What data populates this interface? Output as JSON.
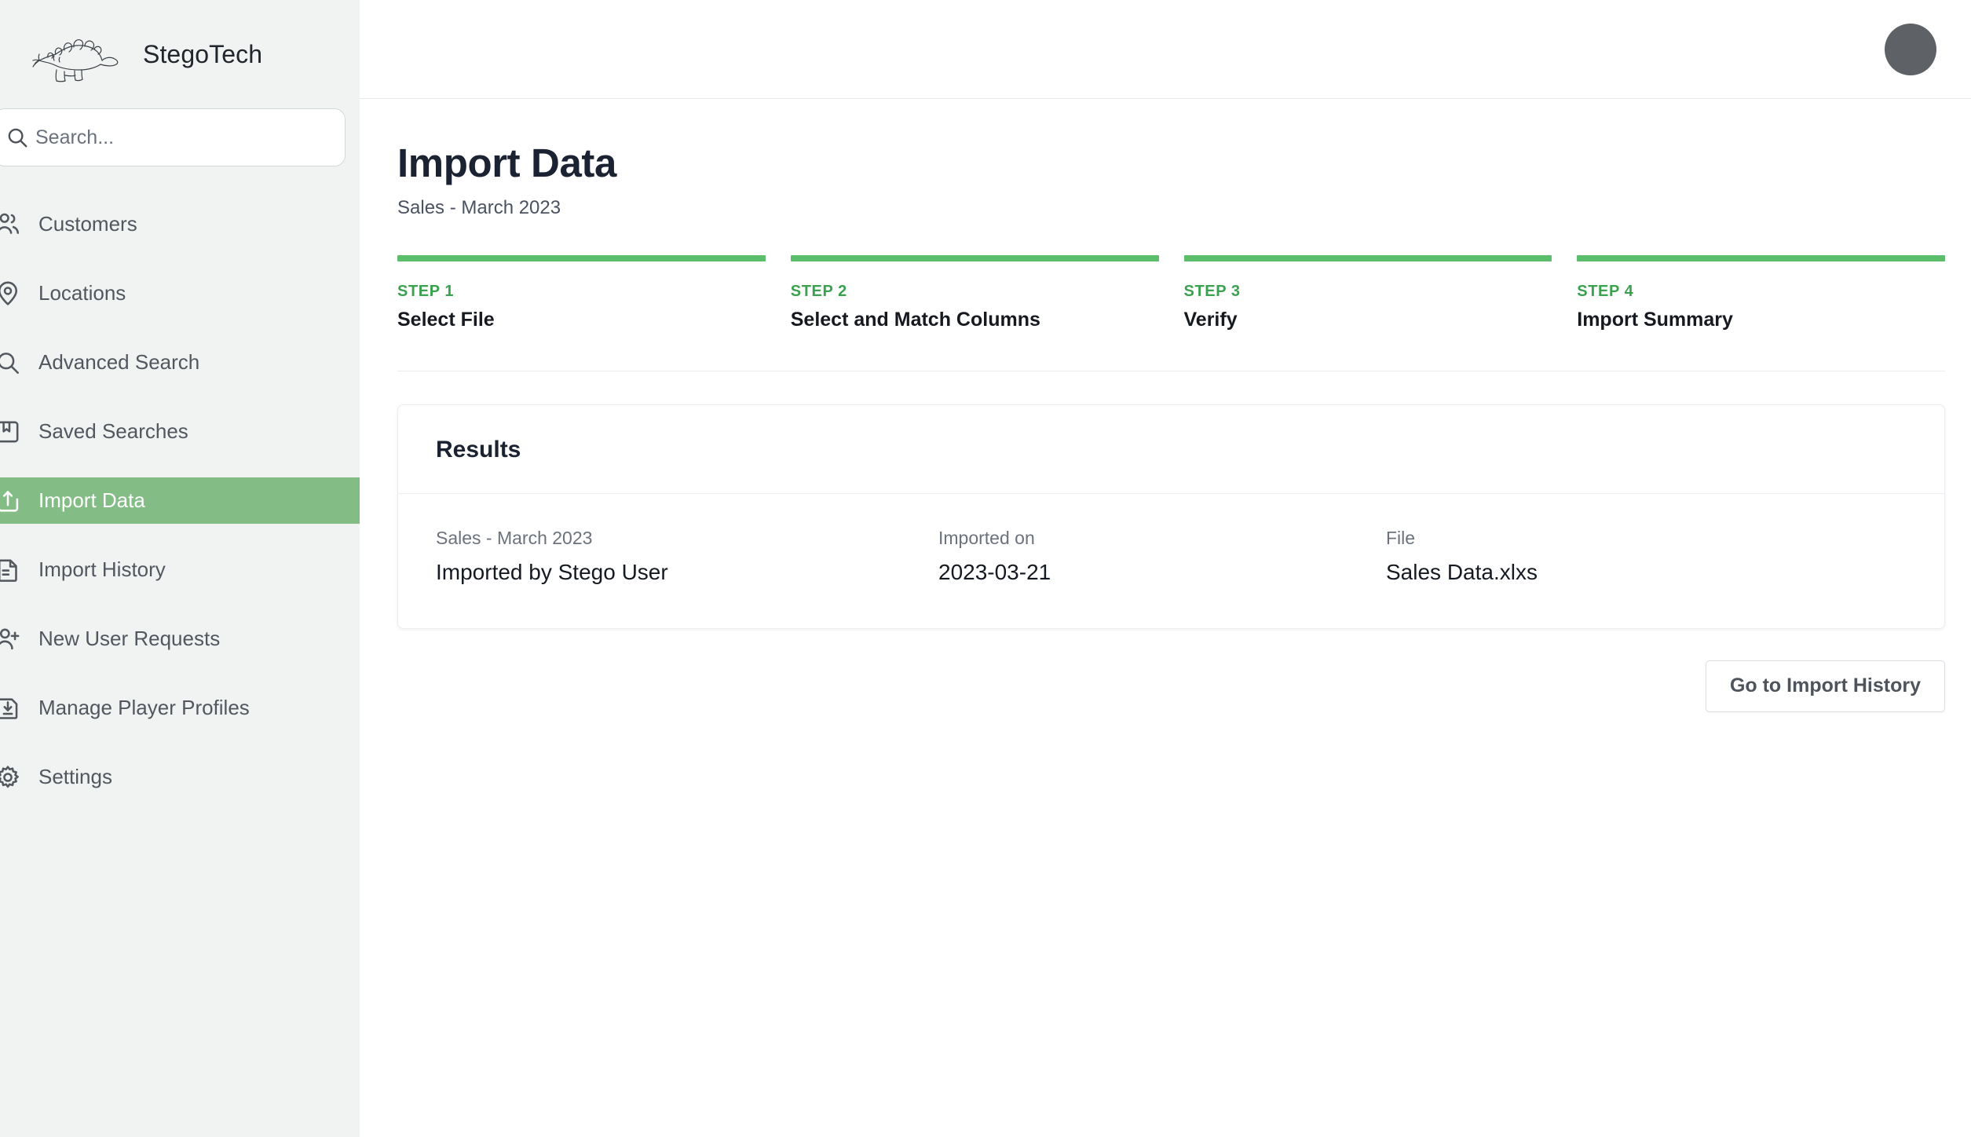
{
  "brand": {
    "name": "StegoTech",
    "logo_icon": "stegosaurus-logo-icon"
  },
  "search": {
    "placeholder": "Search...",
    "value": "",
    "icon": "search-icon"
  },
  "sidebar": {
    "items": [
      {
        "label": "Customers",
        "icon": "users-icon",
        "active": false
      },
      {
        "label": "Locations",
        "icon": "map-pin-icon",
        "active": false
      },
      {
        "label": "Advanced Search",
        "icon": "search-icon",
        "active": false
      },
      {
        "label": "Saved Searches",
        "icon": "bookmark-doc-icon",
        "active": false
      },
      {
        "label": "Import Data",
        "icon": "upload-file-icon",
        "active": true
      },
      {
        "label": "Import History",
        "icon": "list-doc-icon",
        "active": false
      },
      {
        "label": "New User Requests",
        "icon": "user-plus-icon",
        "active": false
      },
      {
        "label": "Manage Player Profiles",
        "icon": "download-file-icon",
        "active": false
      },
      {
        "label": "Settings",
        "icon": "gear-icon",
        "active": false
      }
    ]
  },
  "topbar": {
    "avatar_icon": "avatar",
    "avatar_color": "#5e6166"
  },
  "page": {
    "title": "Import Data",
    "subtitle": "Sales - March 2023"
  },
  "stepper": {
    "accent_color": "#5cbd6b",
    "label_color": "#3aa14e",
    "steps": [
      {
        "index": "STEP 1",
        "name": "Select File",
        "complete": true
      },
      {
        "index": "STEP 2",
        "name": "Select and Match Columns",
        "complete": true
      },
      {
        "index": "STEP 3",
        "name": "Verify",
        "complete": true
      },
      {
        "index": "STEP 4",
        "name": "Import Summary",
        "complete": true
      }
    ]
  },
  "results_card": {
    "title": "Results",
    "fields": [
      {
        "label": "Sales - March 2023",
        "value": "Imported by Stego User"
      },
      {
        "label": "Imported on",
        "value": "2023-03-21"
      },
      {
        "label": "File",
        "value": "Sales Data.xlxs"
      }
    ]
  },
  "actions": {
    "go_to_import_history": "Go to Import History"
  }
}
